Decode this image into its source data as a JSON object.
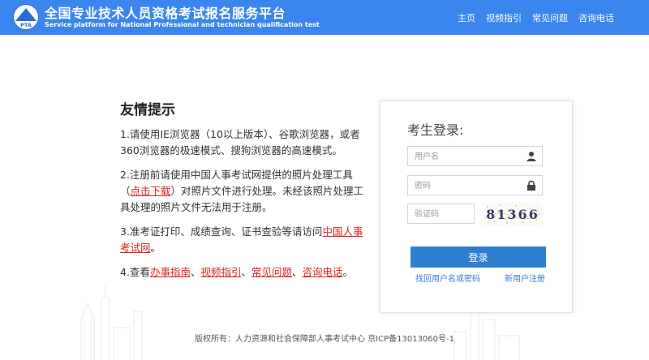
{
  "header": {
    "logo_text": "PTA",
    "title_cn": "全国专业技术人员资格考试报名服务平台",
    "title_en": "Service platform for National Professional and technician qualification test",
    "nav": [
      "主页",
      "视频指引",
      "常见问题",
      "咨询电话"
    ]
  },
  "tips": {
    "heading": "友情提示",
    "tip1": "1.请使用IE浏览器（10以上版本）、谷歌浏览器，或者360浏览器的极速模式、搜狗浏览器的高速模式。",
    "tip2_pre": "2.注册前请使用中国人事考试网提供的照片处理工具（",
    "tip2_link": "点击下载",
    "tip2_post": "）对照片文件进行处理。未经该照片处理工具处理的照片文件无法用于注册。",
    "tip3_pre": "3.准考证打印、成绩查询、证书查验等请访问",
    "tip3_link": "中国人事考试网",
    "tip3_post": "。",
    "tip4_pre": "4.查看",
    "tip4_links": [
      "办事指南",
      "视频指引",
      "常见问题",
      "咨询电话"
    ],
    "sep": "、",
    "tip4_post": "。"
  },
  "login": {
    "title": "考生登录:",
    "username_placeholder": "用户名",
    "password_placeholder": "密码",
    "captcha_placeholder": "验证码",
    "captcha_text": "81366",
    "button": "登录",
    "forgot": "找回用户名或密码",
    "register": "新用户注册"
  },
  "footer": {
    "text": "版权所有：人力资源和社会保障部人事考试中心 京ICP备13013060号-1"
  },
  "colors": {
    "header_bg": "#3a86ee",
    "button_bg": "#2f7fd0",
    "link_red": "#e02020",
    "link_blue": "#2f7fd0"
  }
}
